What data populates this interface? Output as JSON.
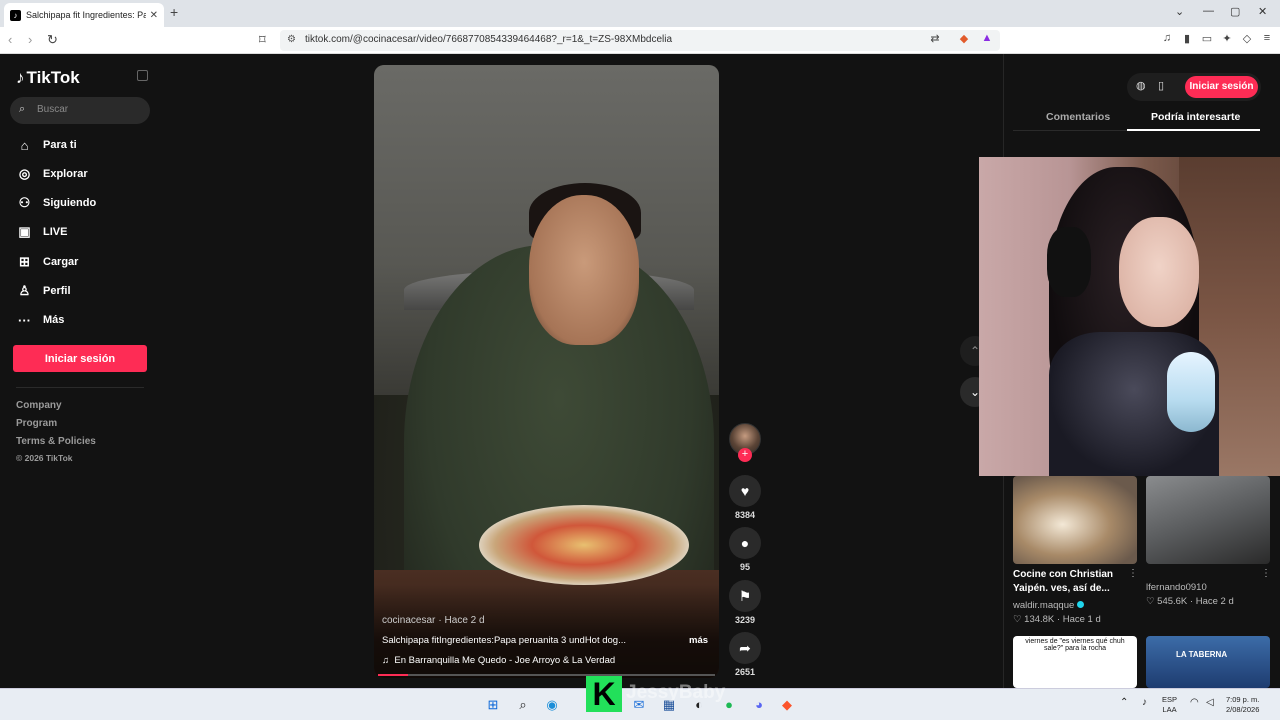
{
  "browser": {
    "tab_title": "Salchipapa fit Ingredientes: Papa",
    "tab_close": "✕",
    "new_tab": "+",
    "url": "tiktok.com/@cocinacesar/video/7668770854339464468?_r=1&_t=ZS-98XMbdcelia",
    "win_min": "⌄",
    "win_min2": "—",
    "win_max": "▢",
    "win_close": "✕"
  },
  "sidebar": {
    "logo": "TikTok",
    "search_placeholder": "Buscar",
    "items": [
      {
        "label": "Para ti",
        "icon": "home-icon"
      },
      {
        "label": "Explorar",
        "icon": "compass-icon"
      },
      {
        "label": "Siguiendo",
        "icon": "following-icon"
      },
      {
        "label": "LIVE",
        "icon": "live-icon"
      },
      {
        "label": "Cargar",
        "icon": "upload-icon"
      },
      {
        "label": "Perfil",
        "icon": "profile-icon"
      },
      {
        "label": "Más",
        "icon": "more-icon"
      }
    ],
    "login_button": "Iniciar sesión",
    "footer": [
      "Company",
      "Program",
      "Terms & Policies",
      "© 2026 TikTok"
    ]
  },
  "video": {
    "author": "cocinacesar",
    "time": "· Hace 2 d",
    "description": "Salchipapa fitIngredientes:Papa peruanita 3 undHot dog...",
    "more": "más",
    "music": "En Barranquilla Me Quedo - Joe Arroyo & La Verdad",
    "progress": 0.09,
    "likes": "8384",
    "comments": "95",
    "saves": "3239",
    "shares": "2651"
  },
  "right_panel": {
    "login_button": "Iniciar sesión",
    "tab_comments": "Comentarios",
    "tab_suggested": "Podría interesarte",
    "cards": [
      {
        "title_line1": "Cocine con Christian",
        "title_line2": "Yaipén. ves, así de...",
        "user": "waldir.maqque",
        "stats": "♡ 134.8K · Hace 1 d"
      },
      {
        "user": "lfernando0910",
        "stats": "♡ 545.6K · Hace 2 d"
      }
    ],
    "thumb3_caption": "viernes de \"es viernes qué chuh sale?\" para la rocha",
    "thumb4_caption": "LA TABERNA"
  },
  "taskbar": {
    "lang1": "ESP",
    "lang2": "LAA",
    "time": "7:09 p. m.",
    "date": "2/08/2026"
  },
  "overlay": {
    "letter": "K",
    "name": "JessyBaby"
  },
  "colors": {
    "accent": "#fe2c55",
    "background": "#121212"
  }
}
